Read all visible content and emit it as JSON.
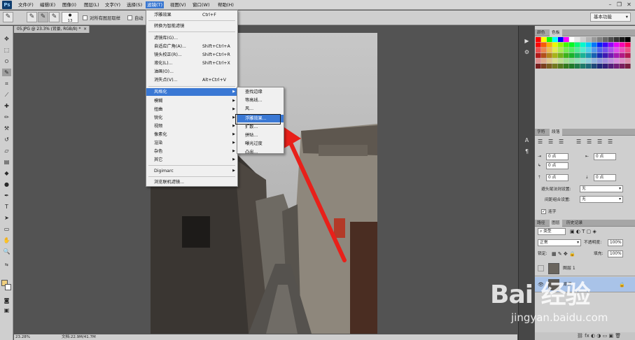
{
  "menubar": {
    "logo": "Ps",
    "items": [
      "文件(F)",
      "编辑(E)",
      "图像(I)",
      "图层(L)",
      "文字(Y)",
      "选择(S)",
      "滤镜(T)",
      "视图(V)",
      "窗口(W)",
      "帮助(H)"
    ],
    "active_index": 6
  },
  "options_bar": {
    "brush_size": "13",
    "sample_all_layers_label": "对所有图层取样",
    "auto_enhance_label": "自动",
    "workspace": "基本功能"
  },
  "document": {
    "tab_title": "05.JPG @ 23.3% (背景, RGB/8) *"
  },
  "status_bar": {
    "zoom": "23.28%",
    "doc_info": "文档:22.9M/41.7M"
  },
  "filter_menu": {
    "top_items": [
      {
        "label": "浮雕效果",
        "shortcut": "Ctrl+F"
      },
      {
        "label": "转换为智能滤镜",
        "shortcut": ""
      }
    ],
    "mid_items": [
      {
        "label": "滤镜库(G)...",
        "shortcut": ""
      },
      {
        "label": "自适应广角(A)...",
        "shortcut": "Shift+Ctrl+A"
      },
      {
        "label": "镜头校正(R)...",
        "shortcut": "Shift+Ctrl+R"
      },
      {
        "label": "液化(L)...",
        "shortcut": "Shift+Ctrl+X"
      },
      {
        "label": "油画(O)...",
        "shortcut": ""
      },
      {
        "label": "消失点(V)...",
        "shortcut": "Alt+Ctrl+V"
      }
    ],
    "sub_items": [
      "风格化",
      "模糊",
      "扭曲",
      "锐化",
      "视频",
      "像素化",
      "渲染",
      "杂色",
      "其它"
    ],
    "highlighted_sub": 0,
    "digimarc": "Digimarc",
    "browse_online": "浏览联机滤镜..."
  },
  "stylize_submenu": {
    "items": [
      "查找边缘",
      "等高线...",
      "风...",
      "浮雕效果...",
      "扩散...",
      "拼贴...",
      "曝光过度",
      "凸出..."
    ],
    "highlighted_index": 3
  },
  "swatches_panel": {
    "tabs": [
      "颜色",
      "色板"
    ],
    "active_tab": 1
  },
  "paragraph_panel": {
    "tabs": [
      "字符",
      "段落"
    ],
    "active_tab": 1,
    "indent_left": "0 点",
    "indent_right": "0 点",
    "indent_first": "0 点",
    "space_before": "0 点",
    "space_after": "0 点",
    "avoid_label": "避头尾法则设置:",
    "avoid_value": "无",
    "spacing_label": "间距组合设置:",
    "spacing_value": "无",
    "hyphenate_label": "连字"
  },
  "layers_panel": {
    "tabs": [
      "路径",
      "图层",
      "历史记录"
    ],
    "active_tab": 1,
    "filter_kind": "类型",
    "blend_mode": "正常",
    "opacity_label": "不透明度:",
    "opacity_value": "100%",
    "lock_label": "锁定:",
    "fill_label": "填充:",
    "fill_value": "100%",
    "layers": [
      {
        "name": "图层 1",
        "visible": false,
        "selected": false
      },
      {
        "name": "背景",
        "visible": true,
        "selected": true
      }
    ]
  },
  "watermark": {
    "main": "Bai 经验",
    "sub": "jingyan.baidu.com"
  },
  "colors": {
    "menu_highlight": "#3a78d4",
    "arrow": "#e8201a",
    "layer_selected": "#a9c3e8"
  }
}
